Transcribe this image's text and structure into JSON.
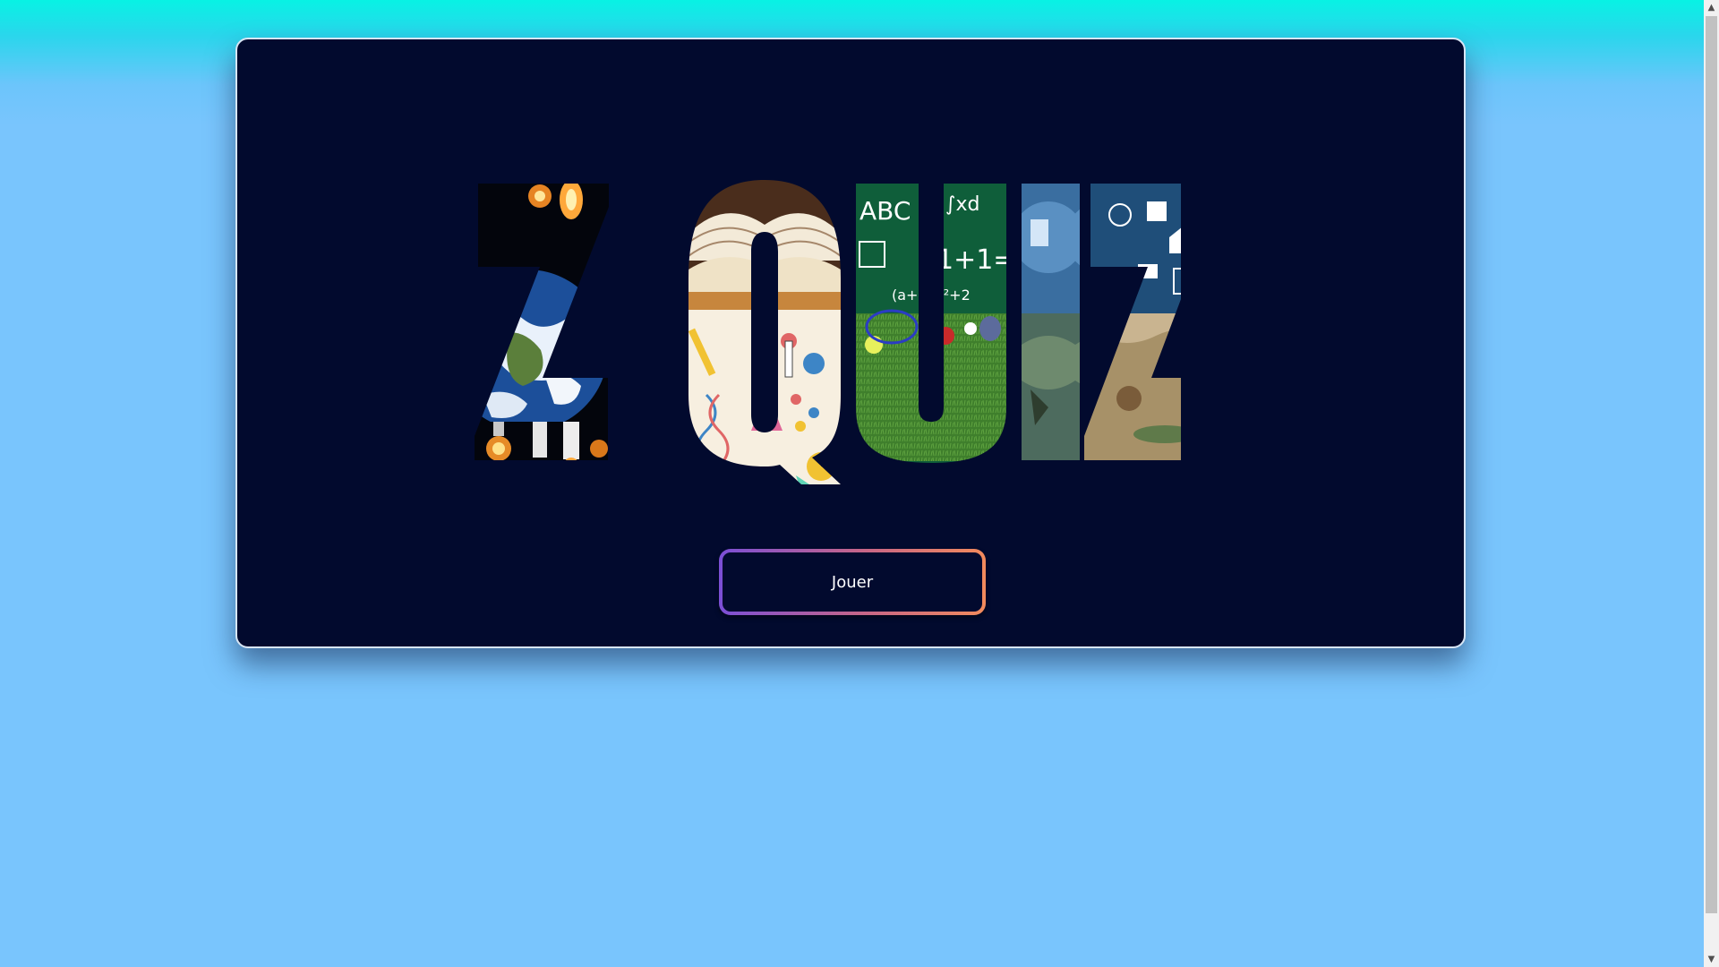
{
  "page": {
    "background_color": "#79c5fd",
    "top_gradient_color": "#08f2e4"
  },
  "card": {
    "background_color": "#020a2e"
  },
  "title": {
    "text": "Z QUIZ"
  },
  "play_button": {
    "label": "Jouer",
    "gradient_start": "#7b4fd6",
    "gradient_end": "#f28a5c"
  },
  "scrollbar": {
    "up_icon": "chevron-up-icon",
    "down_icon": "chevron-down-icon"
  }
}
